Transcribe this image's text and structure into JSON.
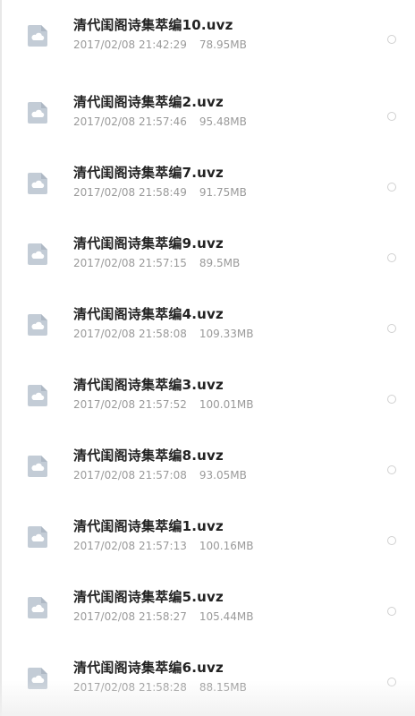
{
  "files": [
    {
      "name": "清代闺阁诗集萃编10.uvz",
      "date": "2017/02/08 21:42:29",
      "size": "78.95MB"
    },
    {
      "name": "清代闺阁诗集萃编2.uvz",
      "date": "2017/02/08 21:57:46",
      "size": "95.48MB"
    },
    {
      "name": "清代闺阁诗集萃编7.uvz",
      "date": "2017/02/08 21:58:49",
      "size": "91.75MB"
    },
    {
      "name": "清代闺阁诗集萃编9.uvz",
      "date": "2017/02/08 21:57:15",
      "size": "89.5MB"
    },
    {
      "name": "清代闺阁诗集萃编4.uvz",
      "date": "2017/02/08 21:58:08",
      "size": "109.33MB"
    },
    {
      "name": "清代闺阁诗集萃编3.uvz",
      "date": "2017/02/08 21:57:52",
      "size": "100.01MB"
    },
    {
      "name": "清代闺阁诗集萃编8.uvz",
      "date": "2017/02/08 21:57:08",
      "size": "93.05MB"
    },
    {
      "name": "清代闺阁诗集萃编1.uvz",
      "date": "2017/02/08 21:57:13",
      "size": "100.16MB"
    },
    {
      "name": "清代闺阁诗集萃编5.uvz",
      "date": "2017/02/08 21:58:27",
      "size": "105.44MB"
    },
    {
      "name": "清代闺阁诗集萃编6.uvz",
      "date": "2017/02/08 21:58:28",
      "size": "88.15MB"
    }
  ],
  "icon": "cloud-file-icon",
  "colors": {
    "icon_fill": "#c3ccd6",
    "name_text": "#222222",
    "meta_text": "#9a9a9a",
    "radio_border": "#d0d0d0"
  }
}
